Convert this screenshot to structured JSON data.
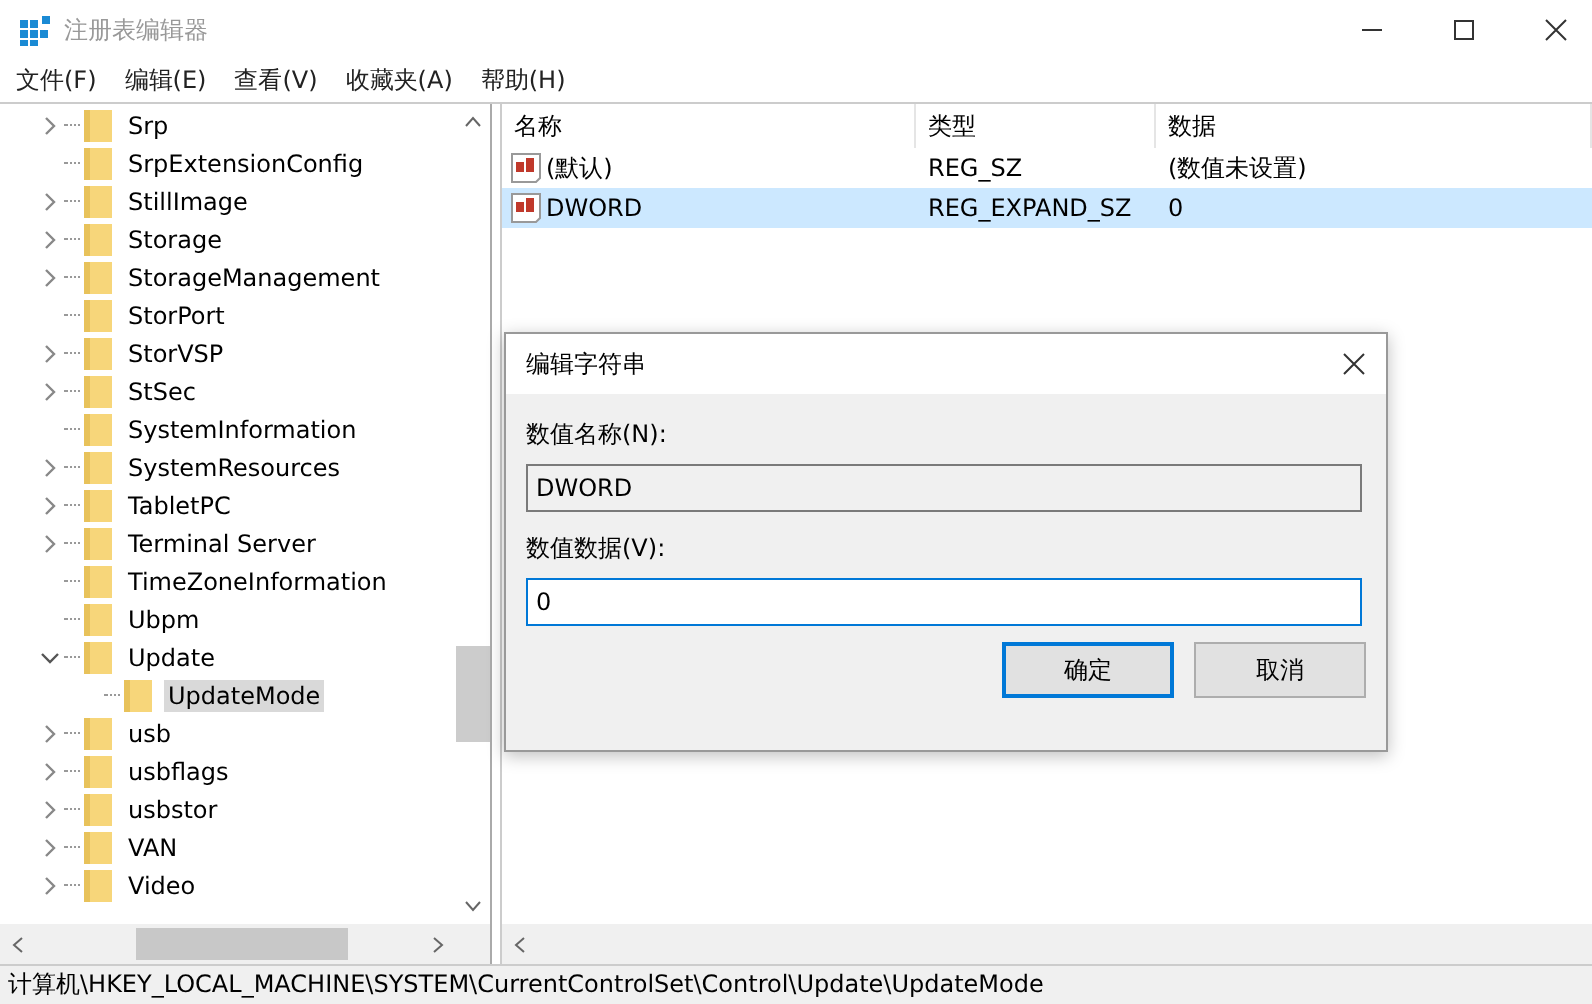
{
  "window": {
    "title": "注册表编辑器"
  },
  "menu": [
    {
      "label": "文件(F)"
    },
    {
      "label": "编辑(E)"
    },
    {
      "label": "查看(V)"
    },
    {
      "label": "收藏夹(A)"
    },
    {
      "label": "帮助(H)"
    }
  ],
  "tree": {
    "items": [
      {
        "label": "Srp",
        "kind": "branch",
        "expanded": false,
        "selected": false
      },
      {
        "label": "SrpExtensionConfig",
        "kind": "leaf",
        "selected": false
      },
      {
        "label": "StillImage",
        "kind": "branch",
        "expanded": false,
        "selected": false
      },
      {
        "label": "Storage",
        "kind": "branch",
        "expanded": false,
        "selected": false
      },
      {
        "label": "StorageManagement",
        "kind": "branch",
        "expanded": false,
        "selected": false
      },
      {
        "label": "StorPort",
        "kind": "leaf",
        "selected": false
      },
      {
        "label": "StorVSP",
        "kind": "branch",
        "expanded": false,
        "selected": false
      },
      {
        "label": "StSec",
        "kind": "branch",
        "expanded": false,
        "selected": false
      },
      {
        "label": "SystemInformation",
        "kind": "leaf",
        "selected": false
      },
      {
        "label": "SystemResources",
        "kind": "branch",
        "expanded": false,
        "selected": false
      },
      {
        "label": "TabletPC",
        "kind": "branch",
        "expanded": false,
        "selected": false
      },
      {
        "label": "Terminal Server",
        "kind": "branch",
        "expanded": false,
        "selected": false
      },
      {
        "label": "TimeZoneInformation",
        "kind": "leaf",
        "selected": false
      },
      {
        "label": "Ubpm",
        "kind": "leaf",
        "selected": false
      },
      {
        "label": "Update",
        "kind": "branch",
        "expanded": true,
        "selected": false,
        "children": [
          {
            "label": "UpdateMode",
            "kind": "leaf",
            "selected": true
          }
        ]
      },
      {
        "label": "usb",
        "kind": "branch",
        "expanded": false,
        "selected": false
      },
      {
        "label": "usbflags",
        "kind": "branch",
        "expanded": false,
        "selected": false
      },
      {
        "label": "usbstor",
        "kind": "branch",
        "expanded": false,
        "selected": false
      },
      {
        "label": "VAN",
        "kind": "branch",
        "expanded": false,
        "selected": false
      },
      {
        "label": "Video",
        "kind": "branch",
        "expanded": false,
        "selected": false
      }
    ]
  },
  "values": {
    "columns": [
      "名称",
      "类型",
      "数据"
    ],
    "rows": [
      {
        "name": "(默认)",
        "type": "REG_SZ",
        "data": "(数值未设置)",
        "selected": false
      },
      {
        "name": "DWORD",
        "type": "REG_EXPAND_SZ",
        "data": "0",
        "selected": true
      }
    ]
  },
  "dialog": {
    "title": "编辑字符串",
    "name_label": "数值名称(N):",
    "name_value": "DWORD",
    "data_label": "数值数据(V):",
    "data_value": "0",
    "buttons": [
      {
        "label": "确定",
        "default": true
      },
      {
        "label": "取消",
        "default": false
      }
    ]
  },
  "status_bar": "计算机\\HKEY_LOCAL_MACHINE\\SYSTEM\\CurrentControlSet\\Control\\Update\\UpdateMode"
}
